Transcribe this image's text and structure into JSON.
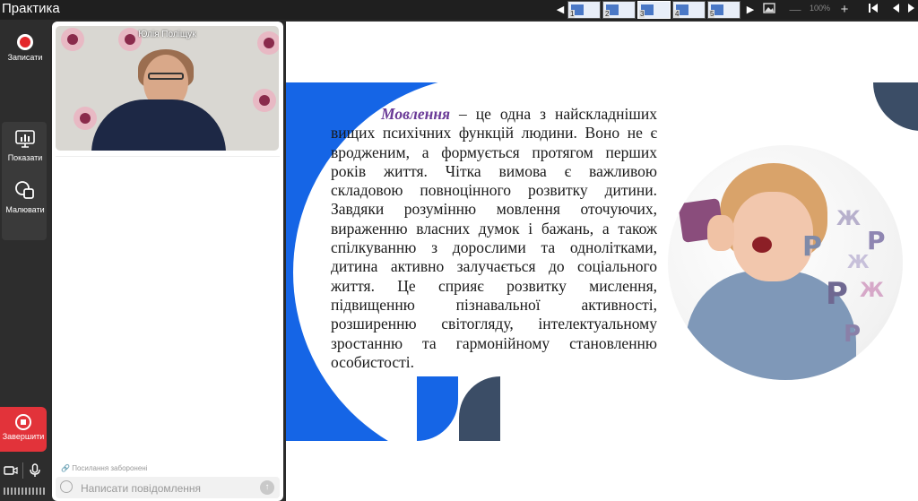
{
  "app": {
    "title": "Практика"
  },
  "toolbar": {
    "thumbnails": [
      {
        "number": "1",
        "active": false
      },
      {
        "number": "2",
        "active": false
      },
      {
        "number": "3",
        "active": true
      },
      {
        "number": "4",
        "active": false
      },
      {
        "number": "5",
        "active": false
      }
    ],
    "zoom_minus": "—",
    "zoom_level": "100%",
    "zoom_plus": "+"
  },
  "sidebar": {
    "record_label": "Записати",
    "show_label": "Показати",
    "draw_label": "Малювати",
    "finish_label": "Завершити"
  },
  "video": {
    "speaker_name": "Юлія Поліщук"
  },
  "chat": {
    "links_note": "Посилання заборонені",
    "input_placeholder": "Написати повідомлення"
  },
  "slide": {
    "term": "Мовлення",
    "text": " – це одна з найскладніших вищих психічних функцій людини. Воно не є вродженим, а формується протягом перших років життя. Чітка вимова є важливою складовою повноцінного розвитку дитини. Завдяки розумінню мовлення оточуючих, вираженню власних думок і бажань, а також спілкуванню з дорослими та однолітками, дитина активно залучається до соціального життя. Це сприяє розвитку мислення, підвищенню пізнавальної активності, розширенню світогляду, інтелектуальному зростанню та гармонійному становленню особистості.",
    "colors": {
      "blue": "#1565e6",
      "slate": "#3b4d66",
      "term": "#6a3a97"
    },
    "photo_letters": [
      "Р",
      "Ж",
      "Р",
      "Ж",
      "Р",
      "Ж",
      "Р"
    ]
  }
}
